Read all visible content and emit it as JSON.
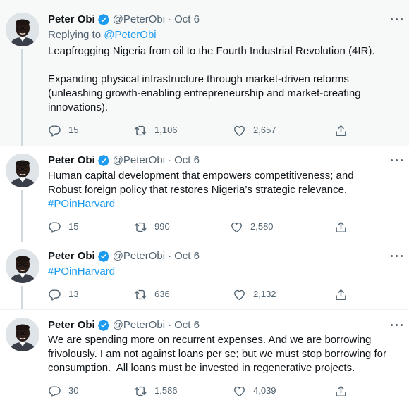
{
  "tweets": [
    {
      "name": "Peter Obi",
      "handle": "@PeterObi",
      "separator": "·",
      "date": "Oct 6",
      "replying_prefix": "Replying to",
      "replying_handle": "@PeterObi",
      "paragraph1": "Leapfrogging Nigeria from oil to the Fourth Industrial Revolution (4IR).",
      "paragraph2_line1": "Expanding physical infrastructure through market-driven reforms",
      "paragraph2_line2": "(unleashing growth-enabling entrepreneurship and market-creating",
      "paragraph2_line3": "innovations).",
      "replies": "15",
      "retweets": "1,106",
      "likes": "2,657"
    },
    {
      "name": "Peter Obi",
      "handle": "@PeterObi",
      "separator": "·",
      "date": "Oct 6",
      "line1": "Human capital development that empowers competitiveness; and",
      "line2": "Robust foreign policy that restores Nigeria’s strategic relevance.",
      "hashtag": "#POinHarvard",
      "replies": "15",
      "retweets": "990",
      "likes": "2,580"
    },
    {
      "name": "Peter Obi",
      "handle": "@PeterObi",
      "separator": "·",
      "date": "Oct 6",
      "hashtag": "#POinHarvard",
      "replies": "13",
      "retweets": "636",
      "likes": "2,132"
    },
    {
      "name": "Peter Obi",
      "handle": "@PeterObi",
      "separator": "·",
      "date": "Oct 6",
      "line1": "We are spending more on recurrent expenses. And we are borrowing",
      "line2": "frivolously. I am not against loans per se; but we must stop borrowing for",
      "line3": "consumption.  All loans must be invested in regenerative projects.",
      "replies": "30",
      "retweets": "1,586",
      "likes": "4,039"
    }
  ],
  "icons": {
    "verified": "verified-badge-icon",
    "more": "more-options-icon",
    "reply": "reply-icon",
    "retweet": "retweet-icon",
    "like": "like-icon",
    "share": "share-icon"
  },
  "colors": {
    "accent": "#1d9bf0",
    "text": "#0f1419",
    "secondary": "#536471",
    "highlight_bg": "#f7f9f9"
  }
}
